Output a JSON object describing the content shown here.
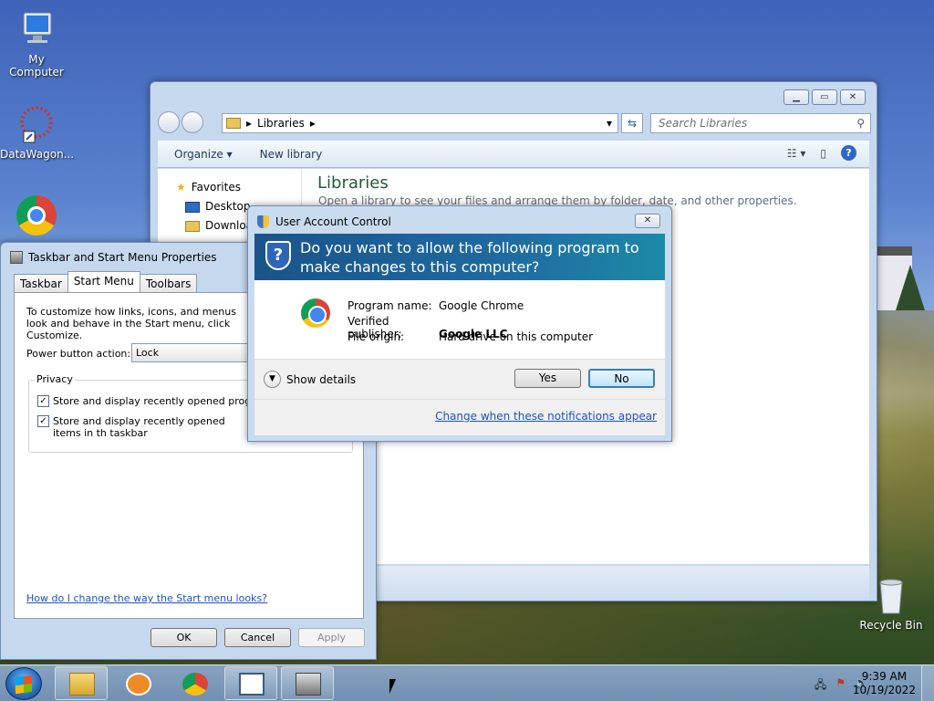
{
  "desktop": {
    "icons": [
      {
        "label": "My Computer"
      },
      {
        "label": "DataWagon..."
      },
      {
        "label": "Recycle Bin"
      }
    ]
  },
  "explorer": {
    "breadcrumb": "Libraries",
    "search_placeholder": "Search Libraries",
    "toolbar": {
      "organize": "Organize",
      "new_library": "New library"
    },
    "nav": [
      {
        "label": "Favorites"
      },
      {
        "label": "Desktop"
      },
      {
        "label": "Downloads"
      }
    ],
    "heading": "Libraries",
    "subheading": "Open a library to see your files and arrange them by folder, date, and other properties."
  },
  "taskbar_props": {
    "title": "Taskbar and Start Menu Properties",
    "tabs": [
      "Taskbar",
      "Start Menu",
      "Toolbars"
    ],
    "description": "To customize how links, icons, and menus look and behave in the Start menu, click Customize.",
    "power_label": "Power button action:",
    "power_value": "Lock",
    "privacy_legend": "Privacy",
    "check1": "Store and display recently opened programs i",
    "check2": "Store and display recently opened items in th taskbar",
    "help_link": "How do I change the way the Start menu looks?",
    "buttons": {
      "ok": "OK",
      "cancel": "Cancel",
      "apply": "Apply"
    }
  },
  "uac": {
    "title": "User Account Control",
    "question": "Do you want to allow the following program to make changes to this computer?",
    "fields": [
      {
        "key": "Program name:",
        "value": "Google Chrome"
      },
      {
        "key": "Verified publisher:",
        "value": "Google LLC"
      },
      {
        "key": "File origin:",
        "value": "Hard drive on this computer"
      }
    ],
    "show_details": "Show details",
    "yes": "Yes",
    "no": "No",
    "notify_link": "Change when these notifications appear"
  },
  "taskbar": {
    "time": "9:39 AM",
    "date": "10/19/2022"
  },
  "colors": {
    "accent": "#1f6aa0",
    "link": "#1a52c8"
  }
}
